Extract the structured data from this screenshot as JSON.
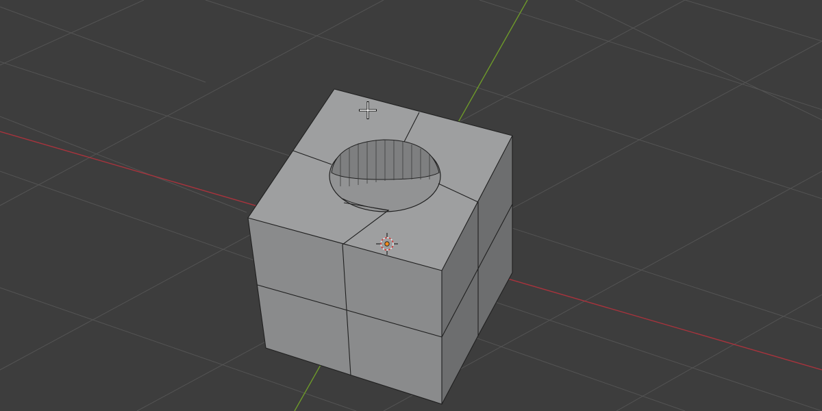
{
  "viewport": {
    "mode": "3d-viewport",
    "object": "cube-with-cylindrical-hole"
  },
  "colors": {
    "background": "#3d3d3d",
    "grid_line": "#545454",
    "x_axis": "#a8333d",
    "y_axis": "#6e9a2a",
    "face_top": "#9e9fa0",
    "face_front": "#8a8b8c",
    "face_right": "#6d6e6f",
    "edge": "#1f1f1f",
    "hole_wall": "#7e7f80",
    "hole_floor": "#929394",
    "origin_dot": "#f08a1e"
  },
  "icons": {
    "cursor": "3d-cursor-icon",
    "origin": "object-origin-icon",
    "pointer": "crosshair-pointer-icon"
  }
}
